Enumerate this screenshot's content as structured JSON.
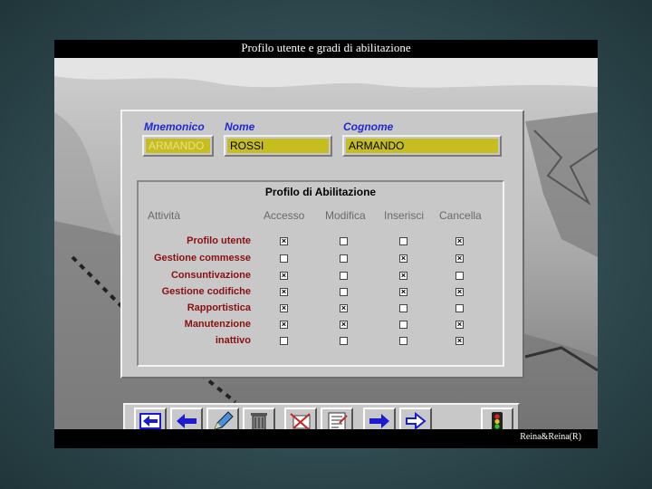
{
  "window": {
    "title": "Profilo utente e gradi di abilitazione",
    "footer": "Reina&Reina(R)"
  },
  "form": {
    "mnemonico": {
      "label": "Mnemonico",
      "value": "ARMANDO"
    },
    "nome": {
      "label": "Nome",
      "value": "ROSSI"
    },
    "cognome": {
      "label": "Cognome",
      "value": "ARMANDO"
    }
  },
  "profile": {
    "title": "Profilo di Abilitazione",
    "columns": [
      "Attività",
      "Accesso",
      "Modifica",
      "Inserisci",
      "Cancella"
    ],
    "rows": [
      {
        "label": "Profilo utente",
        "values": [
          true,
          false,
          false,
          true
        ]
      },
      {
        "label": "Gestione commesse",
        "values": [
          false,
          false,
          true,
          true
        ]
      },
      {
        "label": "Consuntivazione",
        "values": [
          true,
          false,
          true,
          false
        ]
      },
      {
        "label": "Gestione codifiche",
        "values": [
          true,
          false,
          true,
          true
        ]
      },
      {
        "label": "Rapportistica",
        "values": [
          true,
          true,
          false,
          false
        ]
      },
      {
        "label": "Manutenzione",
        "values": [
          true,
          true,
          false,
          true
        ]
      },
      {
        "label": "inattivo",
        "values": [
          false,
          false,
          false,
          true
        ]
      }
    ]
  },
  "toolbar": {
    "buttons": [
      "first-arrow-icon",
      "back-arrow-icon",
      "pen-icon",
      "trash-icon",
      "crossed-card-icon",
      "form-icon",
      "forward-arrow-icon",
      "last-arrow-icon",
      "traffic-light-icon"
    ]
  }
}
